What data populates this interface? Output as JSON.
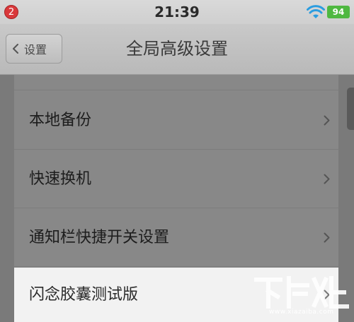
{
  "status_bar": {
    "notification_count": "2",
    "time": "21:39",
    "battery": "94"
  },
  "nav": {
    "back_label": "设置",
    "title": "全局高级设置"
  },
  "list": {
    "items": [
      {
        "label": "本地备份"
      },
      {
        "label": "快速换机"
      },
      {
        "label": "通知栏快捷开关设置"
      },
      {
        "label": "闪念胶囊测试版"
      }
    ]
  },
  "watermark": {
    "text": "www.xiazaiba.com"
  },
  "colors": {
    "battery": "#4fb841",
    "badge": "#d9393b",
    "highlight_row": "#f2f2f2"
  }
}
